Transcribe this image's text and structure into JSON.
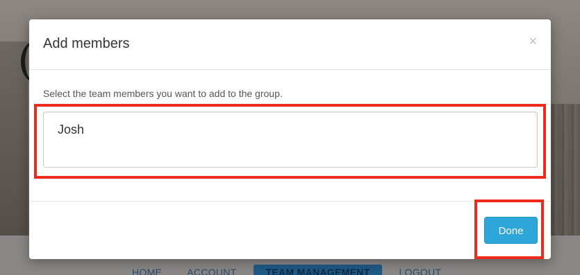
{
  "modal": {
    "title": "Add members",
    "close_label": "×",
    "instruction": "Select the team members you want to add to the group.",
    "members_value": "Josh",
    "done_label": "Done"
  },
  "nav": {
    "items": [
      "HOME",
      "ACCOUNT",
      "TEAM MANAGEMENT",
      "LOGOUT"
    ],
    "active_index": 2
  },
  "colors": {
    "highlight": "#ee2a1b",
    "primary_button": "#2ea6d9",
    "active_nav": "#1f5a86"
  },
  "icons": {
    "close": "close-icon"
  }
}
